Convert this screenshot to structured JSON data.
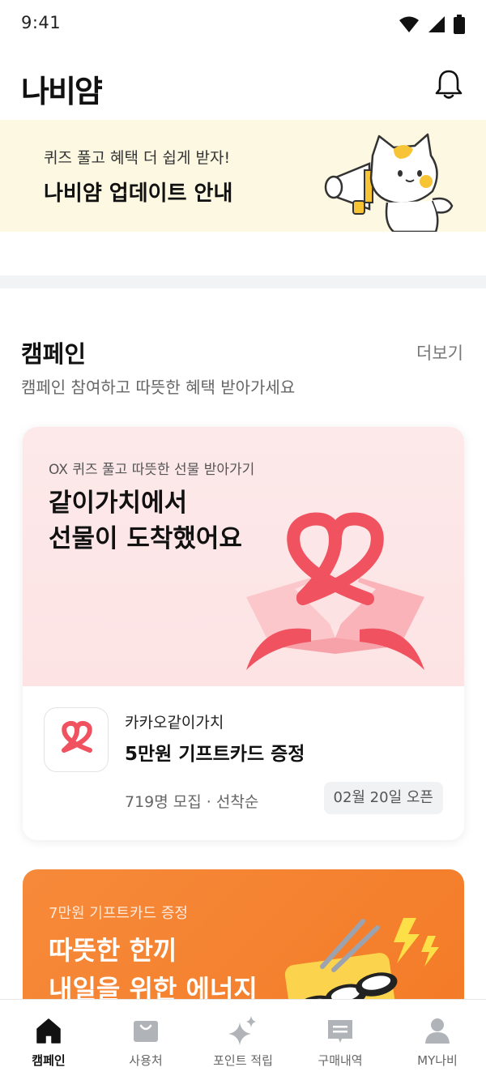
{
  "status": {
    "time": "9:41"
  },
  "header": {
    "logo": "나비얌"
  },
  "banner": {
    "subtitle": "퀴즈 풀고 혜택 더 쉽게 받자!",
    "title": "나비얌 업데이트 안내"
  },
  "campaign": {
    "title": "캠페인",
    "more_label": "더보기",
    "subtitle": "캠페인 참여하고 따뜻한 혜택 받아가세요"
  },
  "cards": [
    {
      "hero_subtitle": "OX 퀴즈 풀고 따뜻한 선물 받아가기",
      "hero_title_line1": "같이가치에서",
      "hero_title_line2": "선물이 도착했어요",
      "org": "카카오같이가치",
      "name": "5만원 기프트카드 증정",
      "meta": "719명 모집 · 선착순",
      "badge": "02월 20일 오픈",
      "accent": "#f0525f"
    },
    {
      "hero_subtitle": "7만원 기프트카드 증정",
      "hero_title_line1": "따뜻한 한끼",
      "hero_title_line2": "내일을 위한 에너지",
      "accent": "#f37a26"
    }
  ],
  "tabs": [
    {
      "label": "캠페인",
      "icon": "home-icon",
      "active": true
    },
    {
      "label": "사용처",
      "icon": "bag-icon",
      "active": false
    },
    {
      "label": "포인트 적립",
      "icon": "sparkle-icon",
      "active": false
    },
    {
      "label": "구매내역",
      "icon": "receipt-icon",
      "active": false
    },
    {
      "label": "MY나비",
      "icon": "person-icon",
      "active": false
    }
  ]
}
